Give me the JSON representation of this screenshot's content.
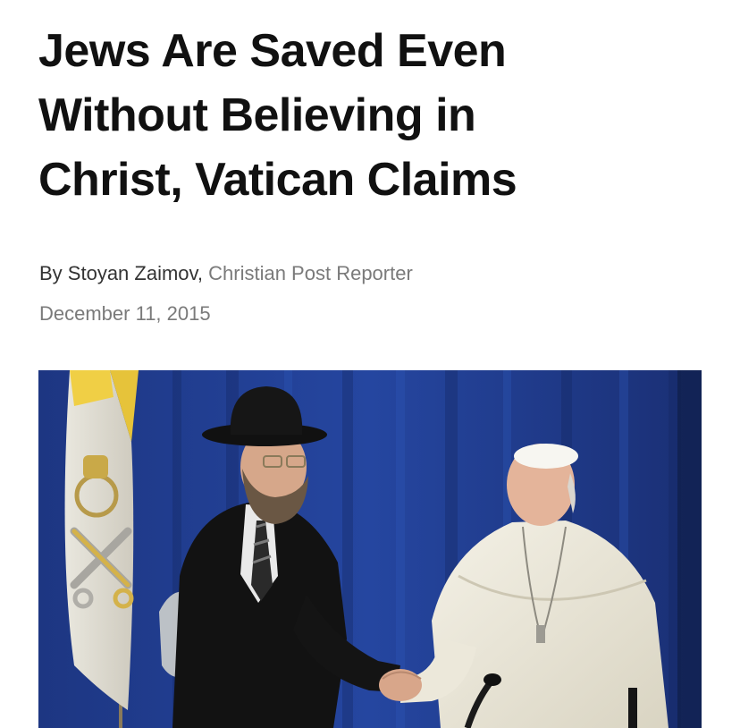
{
  "article": {
    "headline_lines": [
      "Jews Are Saved Even",
      "Without Believing in",
      "Christ, Vatican Claims"
    ],
    "byline": {
      "prefix": "By ",
      "author": "Stoyan Zaimov",
      "separator": ", ",
      "role": "Christian Post Reporter"
    },
    "date": "December 11, 2015"
  },
  "colors": {
    "curtain": "#1f3b8a",
    "headline_text": "#111111",
    "muted_text": "#7a7a7a"
  }
}
